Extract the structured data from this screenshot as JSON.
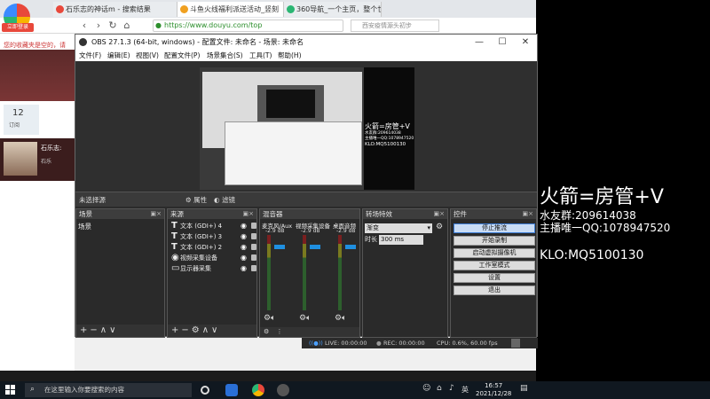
{
  "browser": {
    "tabs": [
      {
        "label": "石乐志的神话m - 搜索结果",
        "active": false
      },
      {
        "label": "斗鱼火线福利派送活动_竖刻",
        "active": true
      },
      {
        "label": "360导航_一个主页，整个世界",
        "active": false
      }
    ],
    "url": "https://www.douyu.com/top",
    "search_placeholder": "西安疫情源头初步",
    "nav": {
      "back": "‹",
      "forward": "›",
      "refresh": "↻",
      "home": "⌂"
    }
  },
  "web_sidebar": {
    "login_badge": "立即登录",
    "notice": "您的收藏夹是空的，请",
    "tile_number": "12",
    "tile_label": "订阅",
    "streamer_name": "石乐志:",
    "streamer_sub": "石乐"
  },
  "obs": {
    "title": "OBS 27.1.3 (64-bit, windows) - 配置文件: 未命名 - 场景: 未命名",
    "window_controls": {
      "min": "—",
      "max": "☐",
      "close": "✕"
    },
    "menu": [
      "文件(F)",
      "编辑(E)",
      "视图(V)",
      "配置文件(P)",
      "场景集合(S)",
      "工具(T)",
      "帮助(H)"
    ],
    "preview_overlay": {
      "line1": "火箭=房管+V",
      "line2": "水友群:209614038",
      "line3": "主播唯一QQ:1078947520",
      "line4": "KLO:MQ5100130"
    },
    "source_toolbar": {
      "no_source": "未选择源",
      "properties": "属性",
      "filters": "滤镜"
    },
    "scenes": {
      "header": "场景",
      "items": [
        "场景"
      ]
    },
    "sources": {
      "header": "来源",
      "items": [
        {
          "icon": "T",
          "label": "文本 (GDI+) 4"
        },
        {
          "icon": "T",
          "label": "文本 (GDI+) 3"
        },
        {
          "icon": "T",
          "label": "文本 (GDI+) 2"
        },
        {
          "icon": "◉",
          "label": "视频采集设备"
        },
        {
          "icon": "▭",
          "label": "显示器采集"
        }
      ]
    },
    "mixer": {
      "header": "混音器",
      "channels": [
        {
          "label": "麦克风/Aux",
          "db": "-2.9 dB"
        },
        {
          "label": "视频采集设备",
          "db": "-2.9 dB"
        },
        {
          "label": "桌面音频",
          "db": "-2.9 dB"
        }
      ]
    },
    "transitions": {
      "header": "转场特效",
      "selected": "渐变",
      "duration_label": "时长",
      "duration_value": "300 ms"
    },
    "controls": {
      "header": "控件",
      "buttons": [
        "停止推流",
        "开始录制",
        "启动虚拟摄像机",
        "工作室模式",
        "设置",
        "退出"
      ]
    },
    "status": {
      "live": "LIVE: 00:00:00",
      "rec": "REC: 00:00:00",
      "cpu": "CPU: 0.6%, 60.00 fps"
    }
  },
  "overlay_right": {
    "line1": "火箭=房管+V",
    "line2": "水友群:209614038",
    "line3": "主播唯一QQ:1078947520",
    "line4": "KLO:MQ5100130"
  },
  "taskbar": {
    "search_placeholder": "在这里输入你要搜索的内容",
    "time": "16:57",
    "date": "2021/12/28",
    "lang": "英"
  }
}
